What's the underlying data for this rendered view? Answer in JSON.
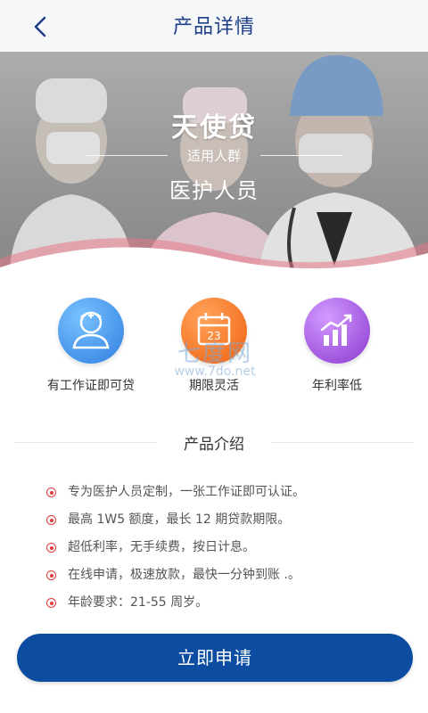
{
  "header": {
    "title": "产品详情",
    "back_icon": "chevron-left-icon"
  },
  "hero": {
    "product_name": "天使贷",
    "subtitle": "适用人群",
    "target_group": "医护人员",
    "image": "medical-staff-photo"
  },
  "features": [
    {
      "label": "有工作证即可贷",
      "icon": "nurse-badge-icon",
      "color": "#3b8fe6"
    },
    {
      "label": "期限灵活",
      "icon": "calendar-icon",
      "color": "#f26a1b"
    },
    {
      "label": "年利率低",
      "icon": "bar-chart-icon",
      "color": "#9b46d9"
    }
  ],
  "watermark": {
    "text_big": "七度网",
    "text_small": "www.7do.net"
  },
  "intro": {
    "title": "产品介绍",
    "items": [
      "专为医护人员定制，一张工作证即可认证。",
      "最高 1W5 额度，最长 12 期贷款期限。",
      "超低利率，无手续费，按日计息。",
      "在线申请，极速放款，最快一分钟到账 .。",
      "年龄要求：21-55 周岁。"
    ]
  },
  "apply_button": {
    "label": "立即申请"
  },
  "colors": {
    "primary": "#0c4da2",
    "title": "#1d3f86",
    "bullet": "#e43b3b"
  }
}
